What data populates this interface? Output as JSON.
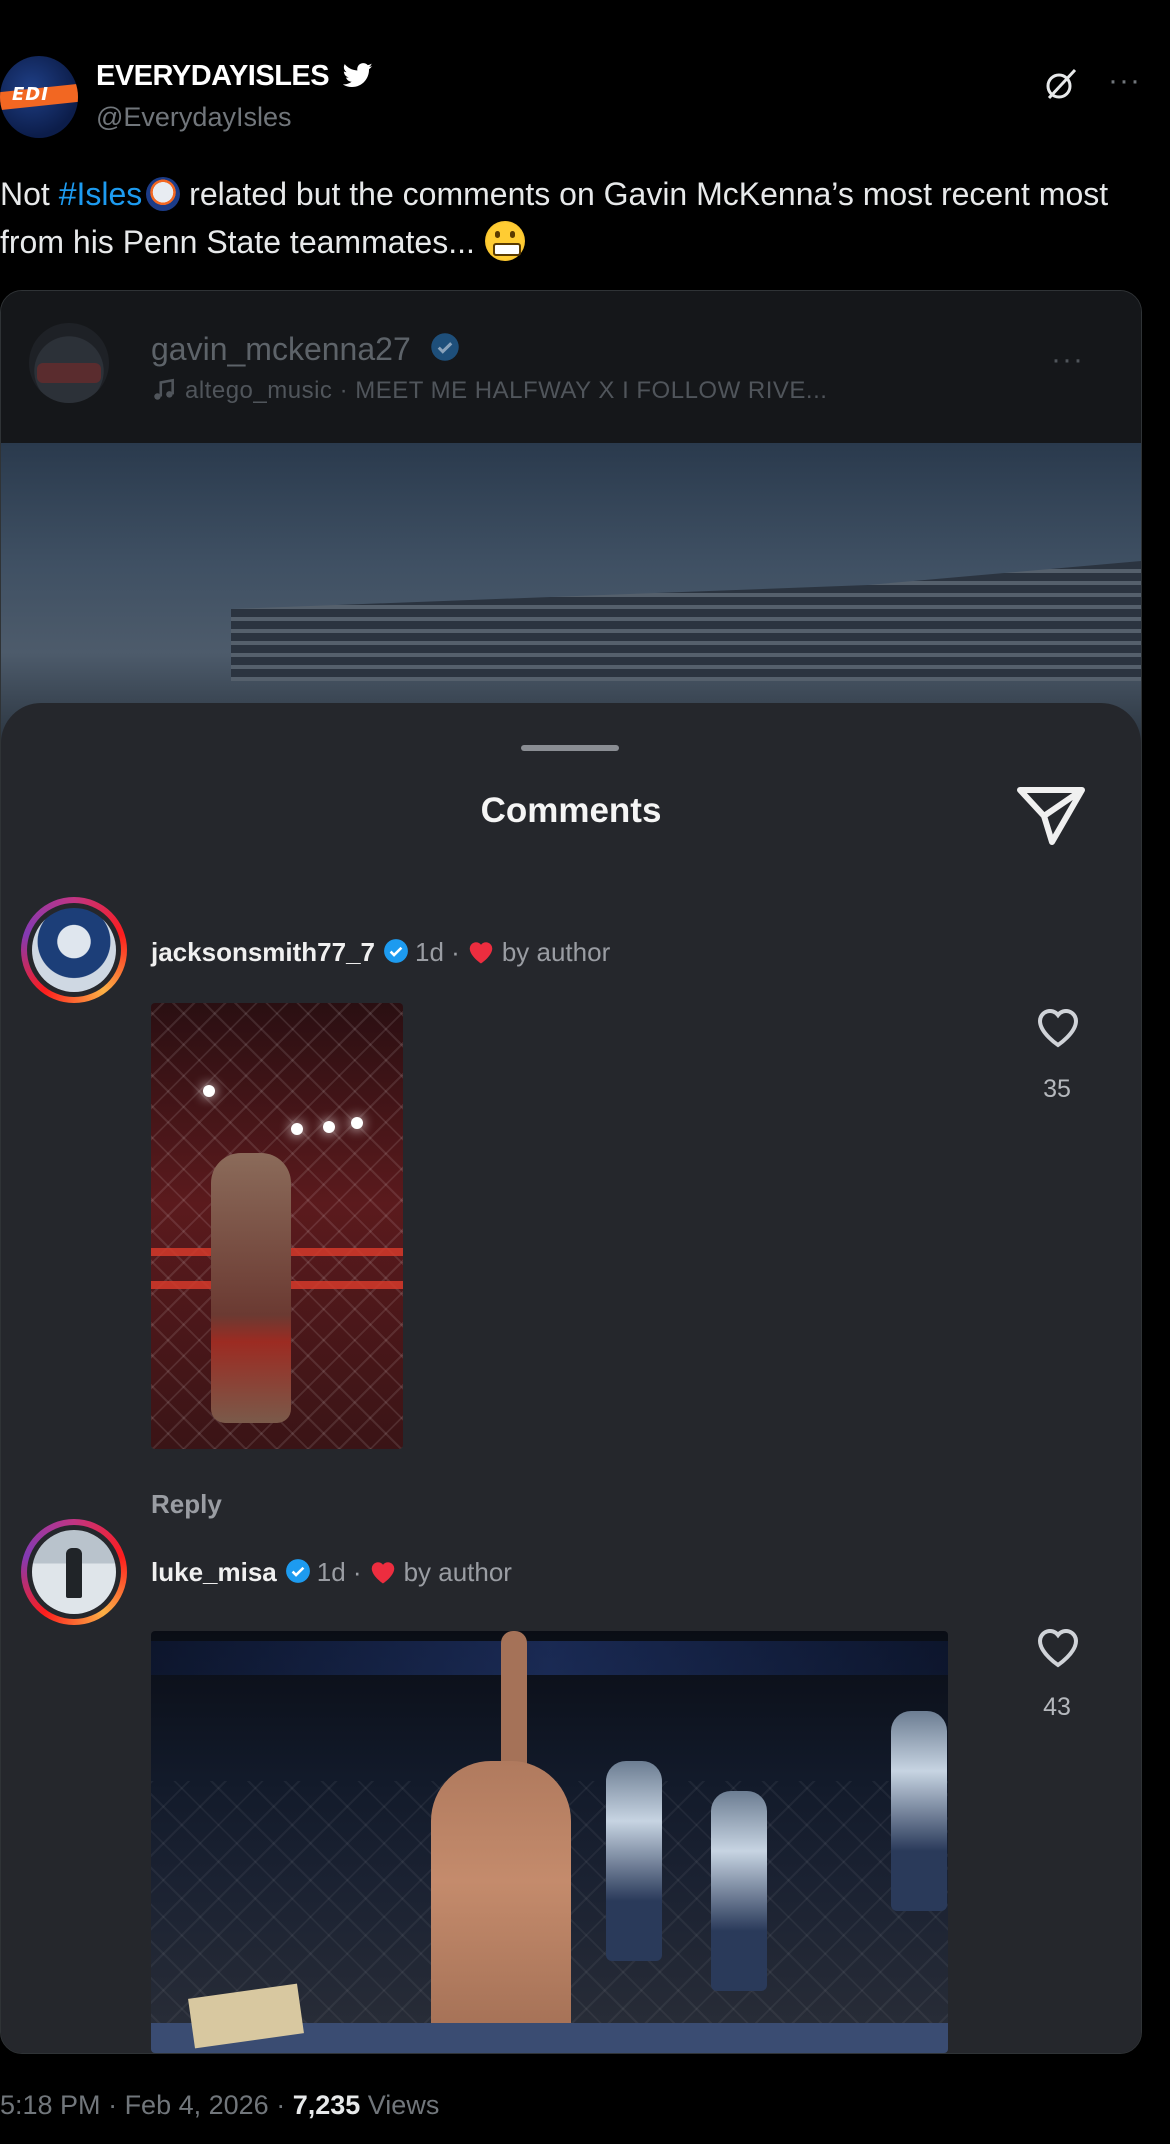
{
  "tweet": {
    "author": {
      "display_name": "EVERYDAYISLES",
      "handle": "@EverydayIsles",
      "avatar_text": "EDI"
    },
    "text_before": "Not ",
    "hashtag": "#Isles",
    "text_after": " related but the comments on Gavin McKenna’s most recent most from his Penn State teammates...",
    "footer": {
      "time": "5:18 PM",
      "date": "Feb 4, 2026",
      "views_count": "7,235",
      "views_label": "Views"
    }
  },
  "embed": {
    "username": "gavin_mckenna27",
    "audio": "altego_music · MEET ME HALFWAY X I FOLLOW RIVE...",
    "sheet_title": "Comments",
    "comments": [
      {
        "username": "jacksonsmith77_7",
        "age": "1d",
        "liked_by": "by author",
        "reply_label": "Reply",
        "likes": "35"
      },
      {
        "username": "luke_misa",
        "age": "1d",
        "liked_by": "by author",
        "likes": "43"
      }
    ]
  },
  "icons": {
    "verified": "verified-badge-icon",
    "heart": "heart-icon",
    "send": "send-icon",
    "music": "music-note-icon",
    "more": "more-icon",
    "grok": "grok-icon"
  },
  "colors": {
    "hashtag": "#1d9bf0",
    "verified": "#1d9bf0",
    "heart_red": "#ed2d3f",
    "background": "#000000",
    "sheet": "#25272c"
  }
}
